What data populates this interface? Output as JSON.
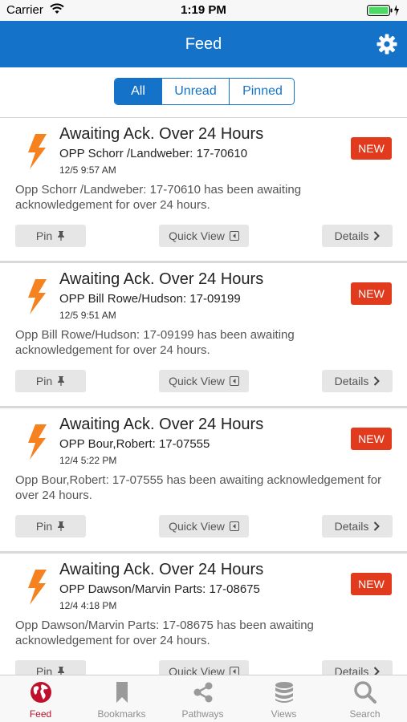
{
  "status_bar": {
    "carrier": "Carrier",
    "time": "1:19 PM"
  },
  "nav": {
    "title": "Feed",
    "settings_icon": "gear-icon"
  },
  "segments": {
    "items": [
      "All",
      "Unread",
      "Pinned"
    ],
    "selected": "All"
  },
  "colors": {
    "accent": "#1473c9",
    "badge": "#e23a1c",
    "bolt": "#f5821f",
    "tab_active": "#c0102c"
  },
  "cards": [
    {
      "title": "Awaiting Ack. Over 24 Hours",
      "subtitle": "OPP Schorr /Landweber: 17-70610",
      "date": "12/5 9:57 AM",
      "badge": "NEW",
      "body": "Opp Schorr /Landweber: 17-70610 has been awaiting acknowledgement for over 24 hours.",
      "pin_label": "Pin",
      "quick_view_label": "Quick View",
      "details_label": "Details"
    },
    {
      "title": "Awaiting Ack. Over 24 Hours",
      "subtitle": "OPP Bill Rowe/Hudson: 17-09199",
      "date": "12/5 9:51 AM",
      "badge": "NEW",
      "body": "Opp Bill Rowe/Hudson: 17-09199 has been awaiting acknowledgement for over 24 hours.",
      "pin_label": "Pin",
      "quick_view_label": "Quick View",
      "details_label": "Details"
    },
    {
      "title": "Awaiting Ack. Over 24 Hours",
      "subtitle": "OPP Bour,Robert: 17-07555",
      "date": "12/4 5:22 PM",
      "badge": "NEW",
      "body": "Opp Bour,Robert: 17-07555 has been awaiting acknowledgement for over 24 hours.",
      "pin_label": "Pin",
      "quick_view_label": "Quick View",
      "details_label": "Details"
    },
    {
      "title": "Awaiting Ack. Over 24 Hours",
      "subtitle": "OPP Dawson/Marvin Parts: 17-08675",
      "date": "12/4 4:18 PM",
      "badge": "NEW",
      "body": "Opp Dawson/Marvin Parts: 17-08675 has been awaiting acknowledgement for over 24 hours.",
      "pin_label": "Pin",
      "quick_view_label": "Quick View",
      "details_label": "Details"
    }
  ],
  "tabs": [
    {
      "label": "Feed",
      "icon": "globe-icon",
      "active": true
    },
    {
      "label": "Bookmarks",
      "icon": "bookmark-icon",
      "active": false
    },
    {
      "label": "Pathways",
      "icon": "share-icon",
      "active": false
    },
    {
      "label": "Views",
      "icon": "database-icon",
      "active": false
    },
    {
      "label": "Search",
      "icon": "search-icon",
      "active": false
    }
  ]
}
